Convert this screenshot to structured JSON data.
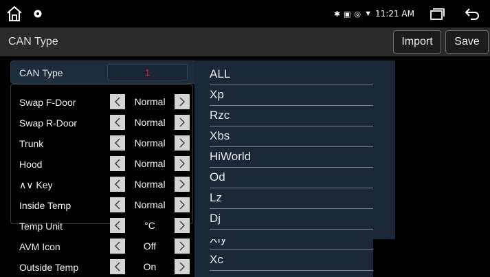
{
  "statusbar": {
    "time": "11:21 AM",
    "indicators": [
      "bluetooth-icon",
      "sim-icon",
      "location-icon",
      "wifi-icon"
    ],
    "glyphs": {
      "bluetooth": "✱",
      "sim": "▣",
      "location": "◎",
      "wifi": "▼"
    }
  },
  "header": {
    "title": "CAN Type",
    "import_label": "Import",
    "save_label": "Save"
  },
  "can_type": {
    "label": "CAN Type",
    "value": "1",
    "value_color": "#e02020"
  },
  "settings": [
    {
      "label": "Swap F-Door",
      "value": "Normal"
    },
    {
      "label": "Swap R-Door",
      "value": "Normal"
    },
    {
      "label": "Trunk",
      "value": "Normal"
    },
    {
      "label": "Hood",
      "value": "Normal"
    },
    {
      "label": "∧∨ Key",
      "value": "Normal"
    },
    {
      "label": "Inside Temp",
      "value": "Normal"
    },
    {
      "label": "Temp Unit",
      "value": "°C"
    },
    {
      "label": "AVM Icon",
      "value": "Off"
    },
    {
      "label": "Outside Temp",
      "value": "On"
    }
  ],
  "dropdown": {
    "options": [
      "ALL",
      "Xp",
      "Rzc",
      "Xbs",
      "HiWorld",
      "Od",
      "Lz",
      "Dj",
      "Xfy",
      "Xc"
    ]
  },
  "colors": {
    "header_bg": "#2a2a2a",
    "panel_bg": "#1f2c3d",
    "dropdown_bg": "#1c2837",
    "arrow_bg": "#d4d4d4"
  }
}
